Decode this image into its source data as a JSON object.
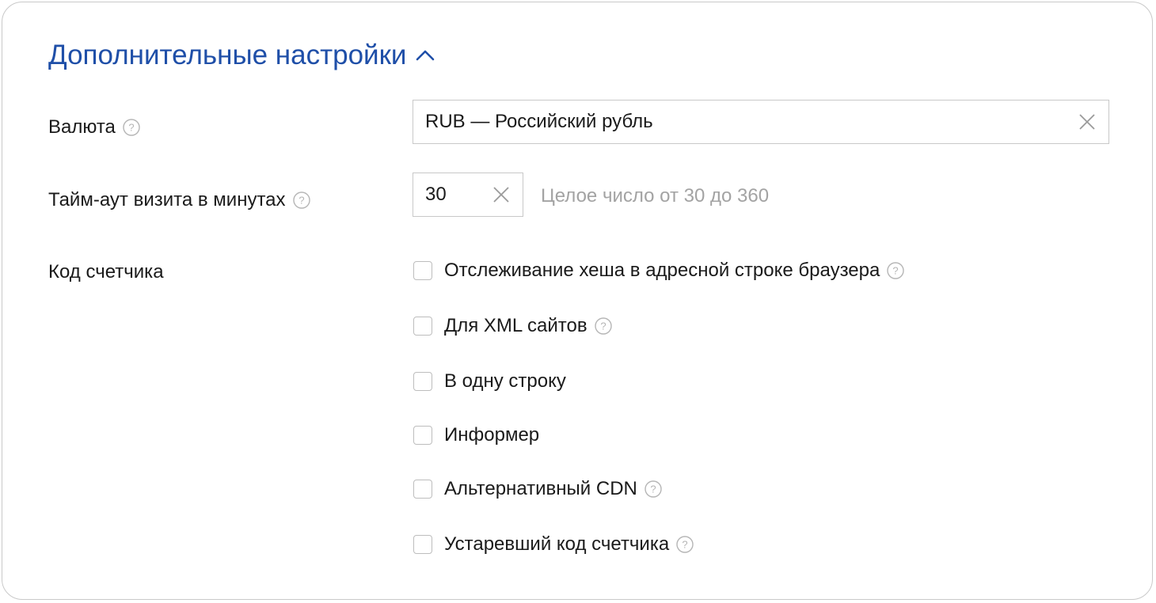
{
  "section": {
    "title": "Дополнительные настройки"
  },
  "currency": {
    "label": "Валюта",
    "value": "RUB — Российский рубль"
  },
  "timeout": {
    "label": "Тайм-аут визита в минутах",
    "value": "30",
    "hint": "Целое число от 30 до 360"
  },
  "counter_code": {
    "label": "Код счетчика",
    "options": [
      {
        "label": "Отслеживание хеша в адресной строке браузера",
        "checked": false,
        "has_help": true
      },
      {
        "label": "Для XML сайтов",
        "checked": false,
        "has_help": true
      },
      {
        "label": "В одну строку",
        "checked": false,
        "has_help": false
      },
      {
        "label": "Информер",
        "checked": false,
        "has_help": false
      },
      {
        "label": "Альтернативный CDN",
        "checked": false,
        "has_help": true
      },
      {
        "label": "Устаревший код счетчика",
        "checked": false,
        "has_help": true
      }
    ]
  },
  "icons": {
    "collapse": "chevron-up-icon",
    "help": "question-circle-icon",
    "clear": "close-icon"
  },
  "colors": {
    "title": "#1f4fa8",
    "text": "#1a1a1a",
    "hint": "#a3a3a3",
    "border": "#c8c8c8"
  }
}
